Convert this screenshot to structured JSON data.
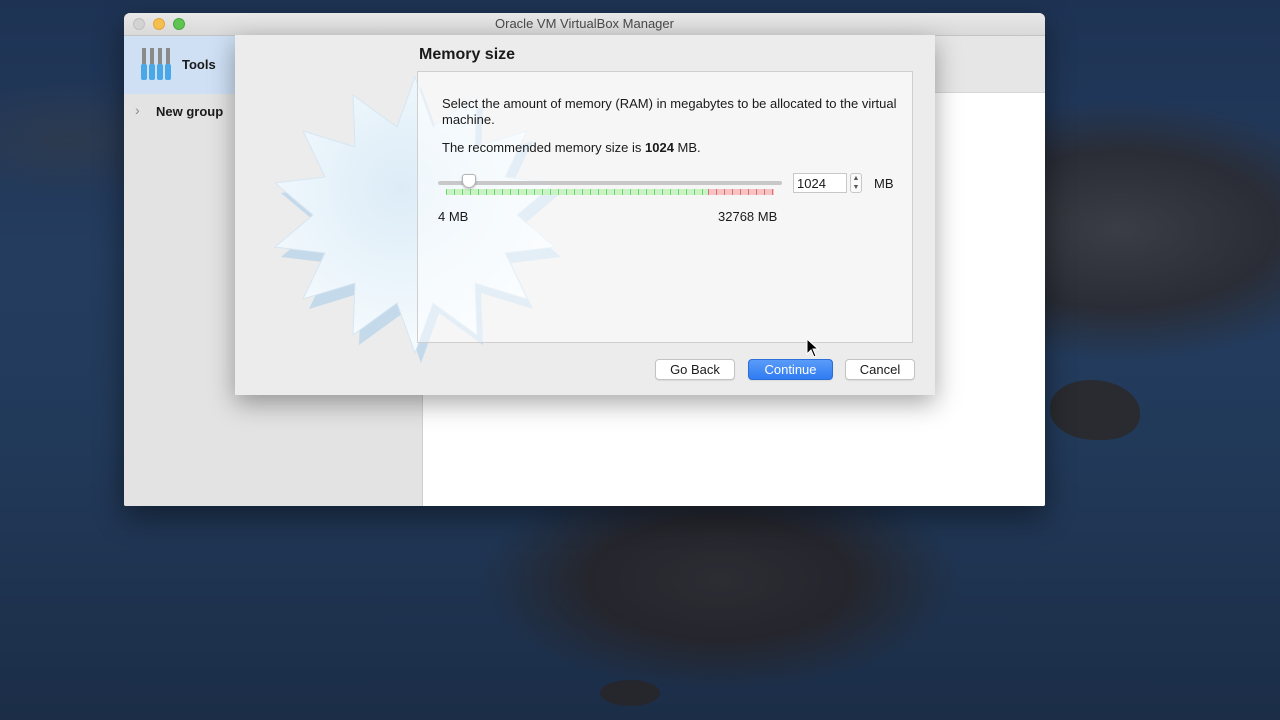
{
  "window": {
    "title": "Oracle VM VirtualBox Manager"
  },
  "sidebar": {
    "tools_label": "Tools",
    "group_label": "New group"
  },
  "dialog": {
    "title": "Memory size",
    "description": "Select the amount of memory (RAM) in megabytes to be allocated to the virtual machine.",
    "recommended_prefix": "The recommended memory size is ",
    "recommended_value": "1024",
    "recommended_suffix": " MB.",
    "slider": {
      "min_label": "4 MB",
      "max_label": "32768 MB",
      "value": 1024,
      "min": 4,
      "max": 32768
    },
    "memory_input_value": "1024",
    "unit_label": "MB",
    "buttons": {
      "back": "Go Back",
      "continue": "Continue",
      "cancel": "Cancel"
    }
  },
  "colors": {
    "accent": "#2f7bf2",
    "slider_ok": "#6ed86e",
    "slider_warn": "#e07070"
  },
  "icons": [
    "tools-icon",
    "chevron-right-icon",
    "toolbox-icon",
    "star-wizard-icon",
    "stepper-up-icon",
    "stepper-down-icon",
    "cursor-icon"
  ]
}
